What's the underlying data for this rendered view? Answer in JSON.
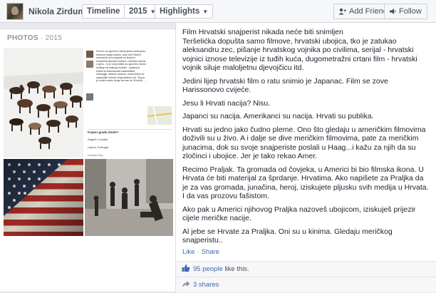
{
  "profile": {
    "name": "Nikola Zirdum"
  },
  "nav": {
    "timeline_label": "Timeline",
    "year_label": "2015",
    "highlights_label": "Highlights"
  },
  "actions": {
    "add_friend_label": "Add Friend",
    "follow_label": "Follow"
  },
  "photos": {
    "header": "PHOTOS",
    "year": "2015",
    "screenshot_text": "Srbi su na ogromnu žalost jedna neshvatno bolesna nacija totalno, zast onih 30ak% normalnih ovo pokazati su klasični dvojdrimenzionalni bolesni i mitovski narcisi u genu - to je ovaj totalni na ogromnu žalost svakog normalnog čovjeka - opasna je bolest ta svetosavska satanistička mitologija, strasno opasna, moze jedna od napsanijih bolesti covjecanstva a je. Tog ta je ovako svako drugo da nas ne bi bolest ...",
    "screenshot_labels": [
      "Kopen gradu Zivite?",
      "Zagreb, Croatia",
      "Lisbon, Portugal",
      "Current City"
    ]
  },
  "post": {
    "paragraphs": [
      "Film Hrvatski snajperist nikada neće biti snimljen\nTeršelićka dopušta samo filmove, hrvatski ubojica, tko je zatukao aleksandru zec, pišanje hrvatskog vojnika po civilima, serijal - hrvatski vojnici iznose televizije iz tuđih kuća, dugometražni crtani film - hrvatski vojnik siluje maloljetnu djevojčicu itd.",
      "Jedini lijep hrvatski film o ratu snimio je Japanac. Film se zove Harissonovo cvijeće.",
      "Jesu li Hrvati nacija? Nisu.",
      "Japanci su nacija. Amerikanci su nacija. Hrvati su publika.",
      "Hrvati su jedno jako čudno pleme. Ono što gledaju u američkim filmovima doživili su u živo. A i dalje se dive meričkim filmovima, pate za meričkim junacima, dok su svoje snajperiste poslali u Haag...i kažu za njih da su zločinci i ubojice. Jer je tako rekao Amer.",
      "Recimo Praljak. Ta gromada od čovjeka, u Americi bi bio filmska ikona. U Hrvata će biti materijal za šprdanje. Hrvatima. Ako napišete za Praljka da je za vas gromada, junačina, heroj, iziskujete pljusku svih medija u Hrvata. I da vas prozovu fašistom.",
      "Ako pak u Americi njihovog Praljka nazoveš ubojicom, iziskuješ prijezir cijele meričke nacije.",
      "Al jebe se Hrvate za Praljka. Oni su u kinima. Gledaju meričkog snajperistu.."
    ],
    "like_label": "Like",
    "share_label": "Share",
    "likes_count": "95 people",
    "likes_suffix": " like this.",
    "shares_label": "3 shares"
  },
  "colors": {
    "link": "#4267b2",
    "bar": "#f6f7f9",
    "page_bg": "#e9eaed"
  },
  "icons": [
    "add-friend-icon",
    "follow-icon",
    "like-thumb-icon",
    "share-arrow-icon",
    "chevron-down-icon"
  ]
}
